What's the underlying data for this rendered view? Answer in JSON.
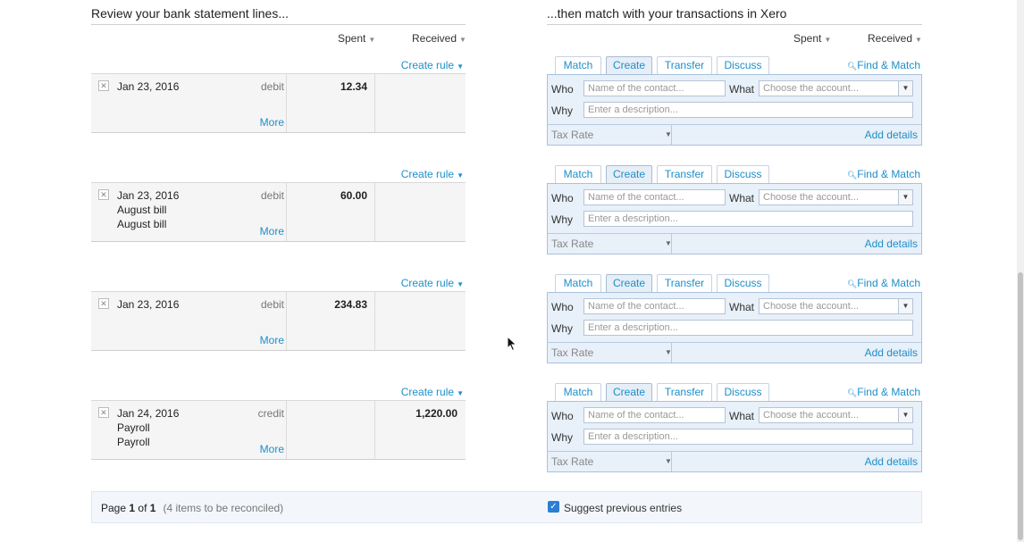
{
  "left": {
    "title": "Review your bank statement lines...",
    "spent_label": "Spent",
    "received_label": "Received",
    "create_rule": "Create rule",
    "more": "More",
    "lines": [
      {
        "date": "Jan 23, 2016",
        "type": "debit",
        "line2": "",
        "line3": "",
        "spent": "12.34",
        "received": ""
      },
      {
        "date": "Jan 23, 2016",
        "type": "debit",
        "line2": "August bill",
        "line3": "August bill",
        "spent": "60.00",
        "received": ""
      },
      {
        "date": "Jan 23, 2016",
        "type": "debit",
        "line2": "",
        "line3": "",
        "spent": "234.83",
        "received": ""
      },
      {
        "date": "Jan 24, 2016",
        "type": "credit",
        "line2": "Payroll",
        "line3": "Payroll",
        "spent": "",
        "received": "1,220.00"
      }
    ]
  },
  "right": {
    "title": "...then match with your transactions in Xero",
    "spent_label": "Spent",
    "received_label": "Received",
    "tabs": [
      "Match",
      "Create",
      "Transfer",
      "Discuss"
    ],
    "find_match": "Find & Match",
    "who_label": "Who",
    "what_label": "What",
    "why_label": "Why",
    "who_placeholder": "Name of the contact...",
    "what_placeholder": "Choose the account...",
    "why_placeholder": "Enter a description...",
    "tax_rate": "Tax Rate",
    "add_details": "Add details"
  },
  "footer": {
    "page_prefix": "Page",
    "page_num": "1",
    "of": "of",
    "page_total": "1",
    "to_be": "(4 items to be reconciled)",
    "suggest": "Suggest previous entries",
    "suggest_checked": true
  },
  "colors": {
    "accent": "#1d8fc9",
    "panel": "#e8f0f9",
    "checkbox": "#2a7fd4"
  }
}
